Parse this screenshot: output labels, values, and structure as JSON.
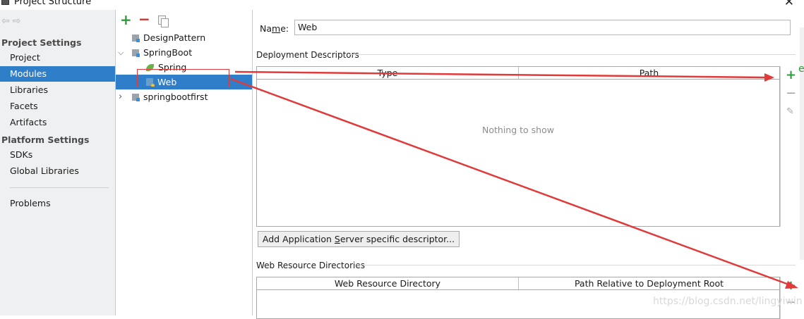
{
  "window": {
    "title": "Project Structure"
  },
  "left_panel": {
    "project_settings_header": "Project Settings",
    "project_settings_items": [
      "Project",
      "Modules",
      "Libraries",
      "Facets",
      "Artifacts"
    ],
    "selected_item": "Modules",
    "platform_settings_header": "Platform Settings",
    "platform_settings_items": [
      "SDKs",
      "Global Libraries"
    ],
    "problems": "Problems"
  },
  "tree": {
    "nodes": [
      "DesignPattern",
      "SpringBoot",
      "Spring",
      "Web",
      "springbootfirst"
    ],
    "selected": "Web"
  },
  "detail": {
    "name_label_prefix": "Na",
    "name_label_mnemonic": "m",
    "name_label_suffix": "e:",
    "name_value": "Web",
    "deployment_descriptors": {
      "title": "Deployment Descriptors",
      "columns": [
        "Type",
        "Path"
      ],
      "empty_text": "Nothing to show"
    },
    "add_descriptor_button": {
      "prefix": "Add Application ",
      "mnemonic": "S",
      "suffix": "erver specific descriptor..."
    },
    "web_resource_directories": {
      "title": "Web Resource Directories",
      "columns": [
        "Web Resource Directory",
        "Path Relative to Deployment Root"
      ]
    }
  },
  "watermark": "https://blog.csdn.net/lingyiwin",
  "colors": {
    "selection": "#2f7ec9",
    "add_green": "#2e9a3c",
    "remove_red": "#c9302c",
    "annotation_red": "#e03a3a"
  }
}
